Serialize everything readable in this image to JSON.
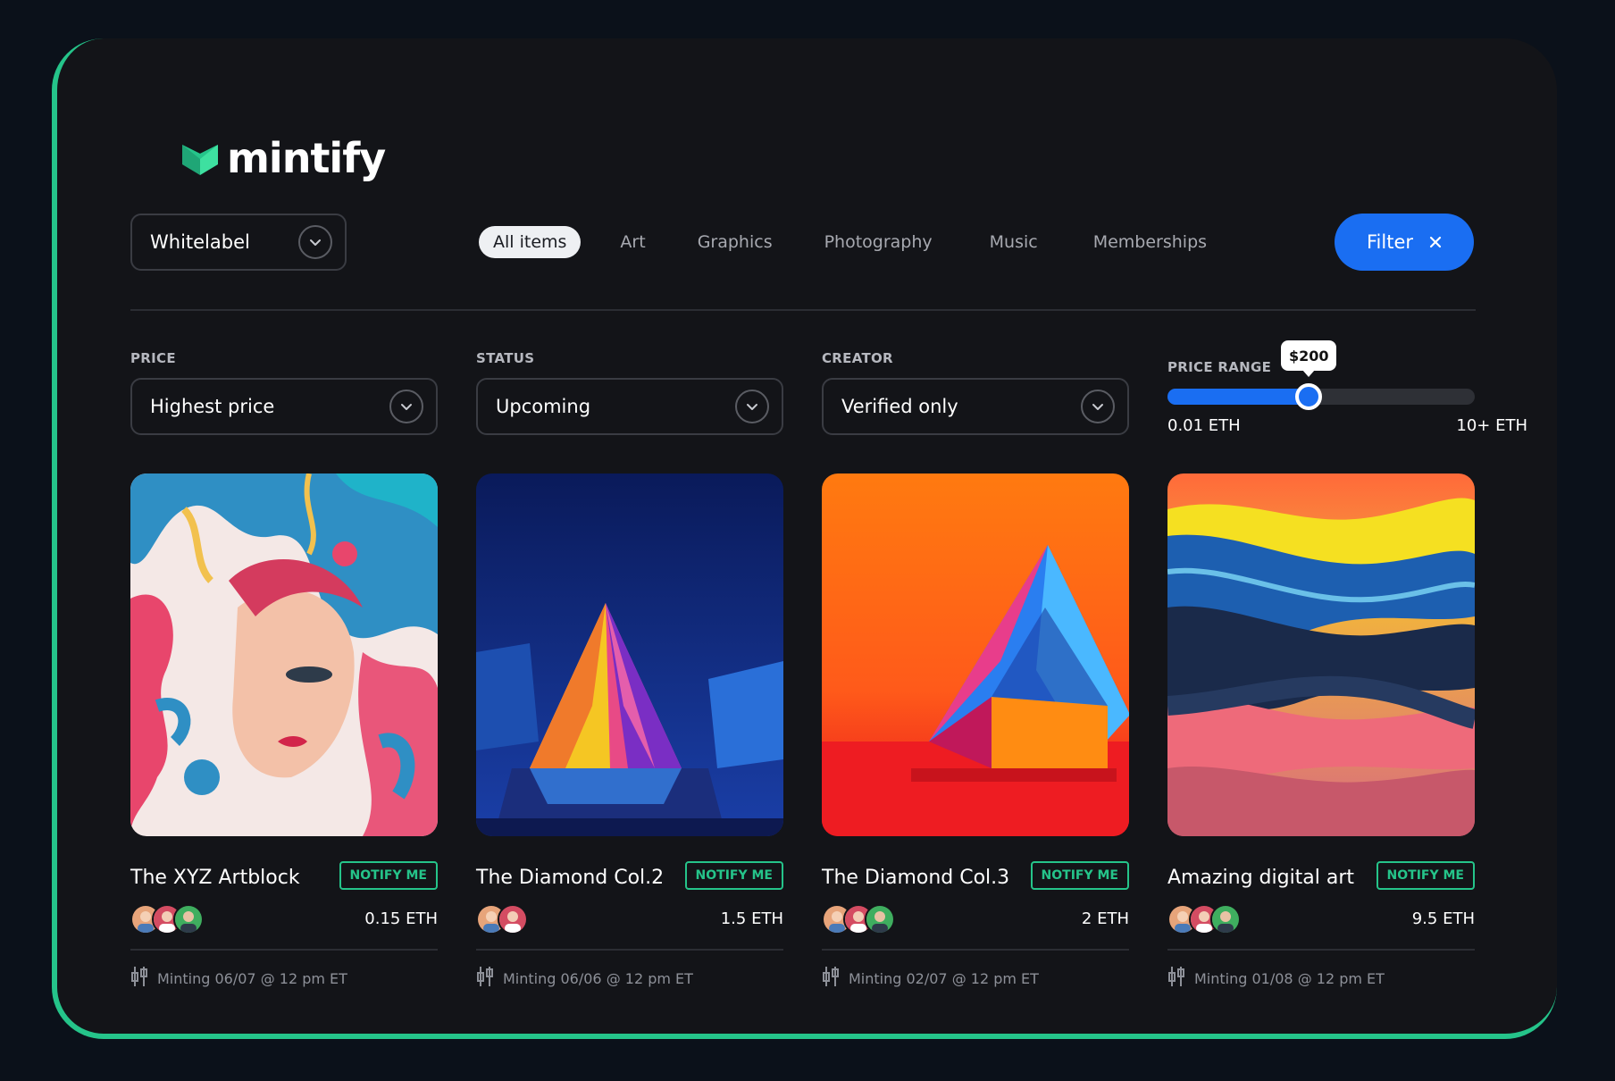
{
  "brand": {
    "name": "mintify",
    "accent": "#25c48a",
    "primary": "#1a6ef2"
  },
  "toolbar": {
    "collection_select": "Whitelabel",
    "tabs": [
      {
        "label": "All items",
        "active": true
      },
      {
        "label": "Art",
        "active": false
      },
      {
        "label": "Graphics",
        "active": false
      },
      {
        "label": "Photography",
        "active": false
      },
      {
        "label": "Music",
        "active": false
      },
      {
        "label": "Memberships",
        "active": false
      }
    ],
    "filter_label": "Filter"
  },
  "filters": {
    "price": {
      "label": "PRICE",
      "value": "Highest price"
    },
    "status": {
      "label": "STATUS",
      "value": "Upcoming"
    },
    "creator": {
      "label": "CREATOR",
      "value": "Verified only"
    },
    "price_range": {
      "label": "PRICE RANGE",
      "tooltip": "$200",
      "min_label": "0.01 ETH",
      "max_label": "10+ ETH",
      "fraction": 0.46
    }
  },
  "cards": [
    {
      "title": "The XYZ Artblock",
      "notify_label": "NOTIFY ME",
      "price": "0.15 ETH",
      "minting": "Minting 06/07 @ 12 pm ET",
      "avatar_count": 3
    },
    {
      "title": "The Diamond Col.2",
      "notify_label": "NOTIFY ME",
      "price": "1.5 ETH",
      "minting": "Minting 06/06 @ 12 pm ET",
      "avatar_count": 2
    },
    {
      "title": "The Diamond Col.3",
      "notify_label": "NOTIFY ME",
      "price": "2 ETH",
      "minting": "Minting 02/07 @ 12 pm ET",
      "avatar_count": 3
    },
    {
      "title": "Amazing digital art",
      "notify_label": "NOTIFY ME",
      "price": "9.5 ETH",
      "minting": "Minting 01/08 @ 12 pm ET",
      "avatar_count": 3
    }
  ],
  "icons": {
    "logo": "mintify-logo-icon",
    "dropdown": "chevron-down-icon",
    "filter_close": "close-icon",
    "minting": "candlestick-icon"
  }
}
